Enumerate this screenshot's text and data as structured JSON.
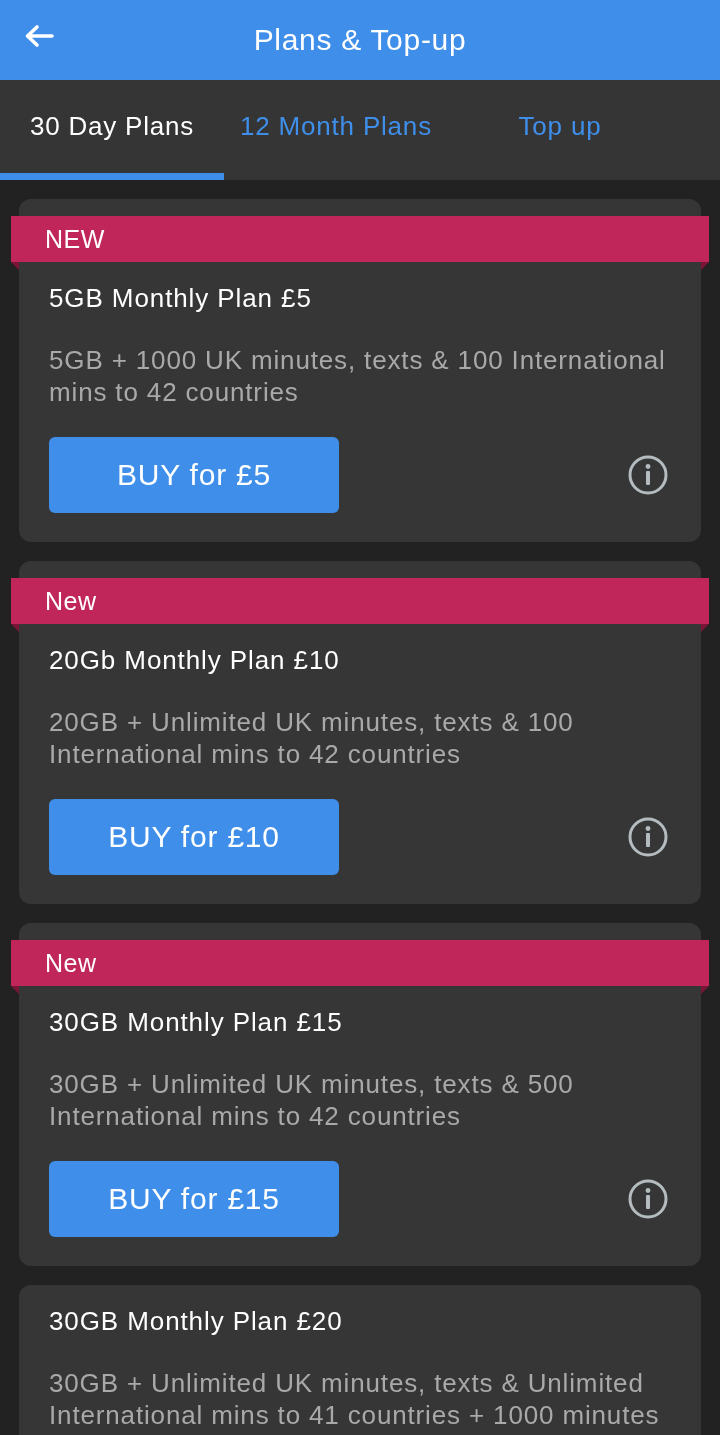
{
  "header": {
    "title": "Plans & Top-up"
  },
  "tabs": [
    {
      "label": "30 Day Plans",
      "selected": true
    },
    {
      "label": "12 Month Plans",
      "selected": false
    },
    {
      "label": "Top up",
      "selected": false
    }
  ],
  "plans": [
    {
      "ribbon": "NEW",
      "title": "5GB Monthly Plan £5",
      "description": "5GB + 1000 UK minutes, texts & 100 International mins to 42 countries",
      "button": "BUY for £5"
    },
    {
      "ribbon": "New",
      "title": "20Gb Monthly Plan £10",
      "description": "20GB + Unlimited UK minutes, texts & 100 International mins to 42 countries",
      "button": "BUY for £10"
    },
    {
      "ribbon": "New",
      "title": "30GB Monthly Plan £15",
      "description": "30GB + Unlimited UK minutes, texts & 500 International mins to 42 countries",
      "button": "BUY for £15"
    },
    {
      "title": "30GB Monthly Plan £20",
      "description": "30GB + Unlimited UK minutes, texts & Unlimited International mins to 41 countries + 1000 minutes"
    }
  ]
}
